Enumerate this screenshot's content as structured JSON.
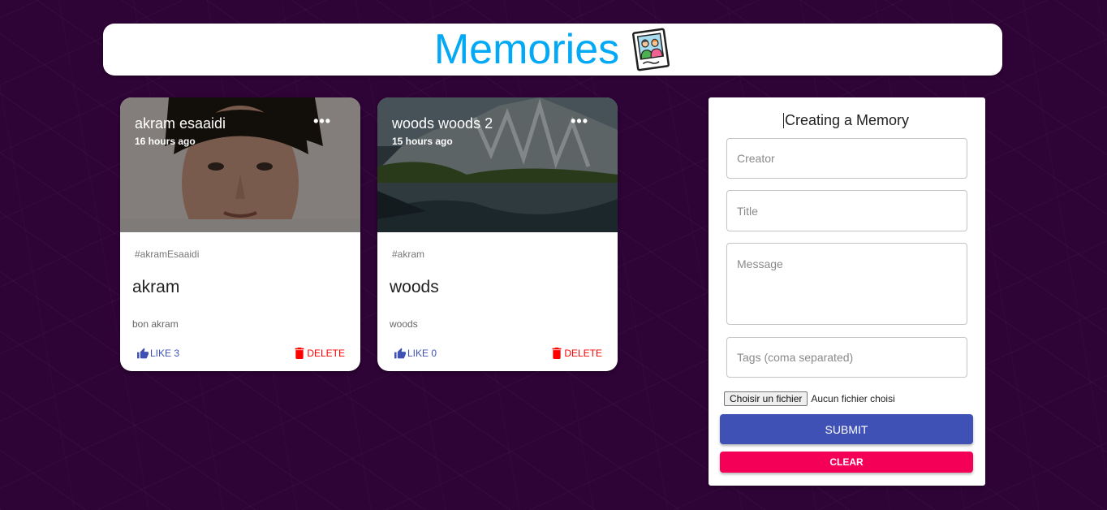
{
  "appbar": {
    "title": "Memories",
    "logo_icon": "memories-photo-icon"
  },
  "posts": [
    {
      "creator": "akram esaaidi",
      "time": "16 hours ago",
      "tags": "#akramEsaaidi",
      "title": "akram",
      "message": "bon akram",
      "like_label": "LIKE 3",
      "delete_label": "DELETE",
      "image": "portrait-photo"
    },
    {
      "creator": "woods woods 2",
      "time": "15 hours ago",
      "tags": "#akram",
      "title": "woods",
      "message": "woods",
      "like_label": "LIKE 0",
      "delete_label": "DELETE",
      "image": "lake-cliff-landscape-photo"
    }
  ],
  "form": {
    "title": "Creating a Memory",
    "creator_placeholder": "Creator",
    "title_placeholder": "Title",
    "message_placeholder": "Message",
    "tags_placeholder": "Tags (coma separated)",
    "file_button": "Choisir un fichier",
    "file_status": "Aucun fichier choisi",
    "submit_label": "SUBMIT",
    "clear_label": "CLEAR"
  },
  "colors": {
    "background": "#2e0336",
    "title": "#03a9f4",
    "primary": "#3f51b5",
    "secondary": "#f50057",
    "delete": "#ff0000"
  }
}
